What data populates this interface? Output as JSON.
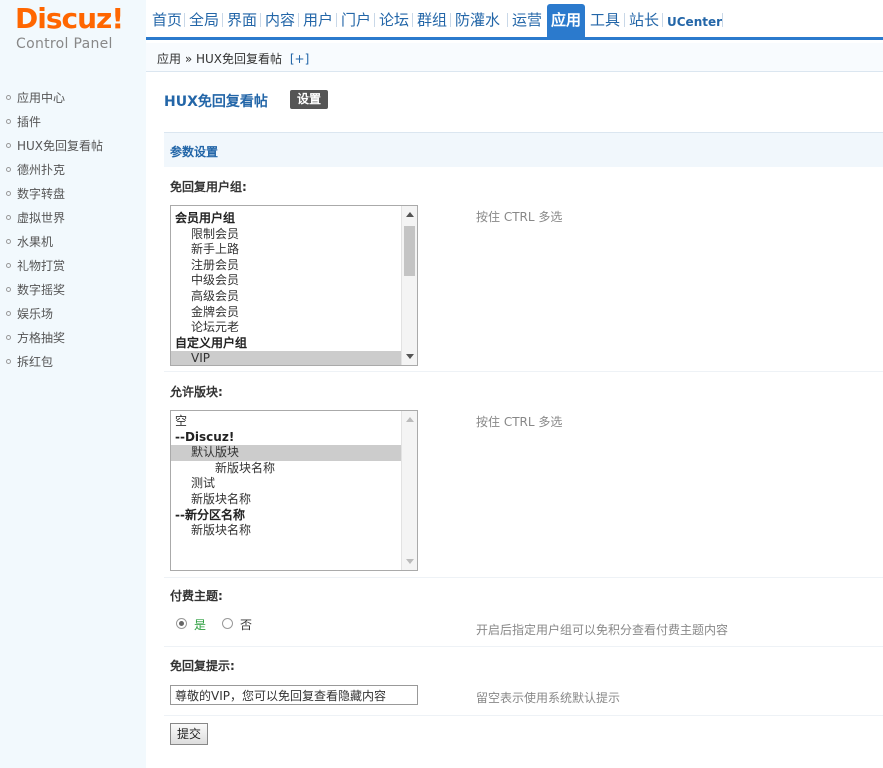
{
  "logo": {
    "title": "Discuz!",
    "subtitle": "Control Panel"
  },
  "topnav": [
    "首页",
    "全局",
    "界面",
    "内容",
    "用户",
    "门户",
    "论坛",
    "群组",
    "防灌水",
    "运营",
    "应用",
    "工具",
    "站长",
    "UCenter"
  ],
  "breadcrumb": {
    "text": "应用 » HUX免回复看帖",
    "plus": "[+]"
  },
  "sidebar": [
    "应用中心",
    "插件",
    "HUX免回复看帖",
    "德州扑克",
    "数字转盘",
    "虚拟世界",
    "水果机",
    "礼物打赏",
    "数字摇奖",
    "娱乐场",
    "方格抽奖",
    "拆红包"
  ],
  "page": {
    "title": "HUX免回复看帖",
    "tab": "设置"
  },
  "section": {
    "title": "参数设置"
  },
  "fields": {
    "groups": {
      "label": "免回复用户组:",
      "tip": "按住 CTRL 多选",
      "options": [
        {
          "text": "会员用户组",
          "type": "grp"
        },
        {
          "text": "限制会员",
          "type": "in1"
        },
        {
          "text": "新手上路",
          "type": "in1"
        },
        {
          "text": "注册会员",
          "type": "in1"
        },
        {
          "text": "中级会员",
          "type": "in1"
        },
        {
          "text": "高级会员",
          "type": "in1"
        },
        {
          "text": "金牌会员",
          "type": "in1"
        },
        {
          "text": "论坛元老",
          "type": "in1"
        },
        {
          "text": "自定义用户组",
          "type": "grp"
        },
        {
          "text": "VIP",
          "type": "in1",
          "selected": true
        }
      ]
    },
    "forums": {
      "label": "允许版块:",
      "tip": "按住 CTRL 多选",
      "options": [
        {
          "text": "空",
          "type": "plain"
        },
        {
          "text": "--Discuz!",
          "type": "grp"
        },
        {
          "text": "默认版块",
          "type": "in1",
          "selected": true
        },
        {
          "text": "新版块名称",
          "type": "in2"
        },
        {
          "text": "测试",
          "type": "in1"
        },
        {
          "text": "新版块名称",
          "type": "in1"
        },
        {
          "text": "--新分区名称",
          "type": "grp"
        },
        {
          "text": "新版块名称",
          "type": "in1"
        }
      ]
    },
    "paid": {
      "label": "付费主题:",
      "yes": "是",
      "no": "否",
      "tip": "开启后指定用户组可以免积分查看付费主题内容"
    },
    "hint": {
      "label": "免回复提示:",
      "value": "尊敬的VIP，您可以免回复查看隐藏内容",
      "tip": "留空表示使用系统默认提示"
    }
  },
  "submit": "提交",
  "colors": {
    "accent": "#2b7acd",
    "logo": "#ff6600",
    "sidebar_bg": "#f2f9fd",
    "yes_text": "#2a9d3c"
  }
}
